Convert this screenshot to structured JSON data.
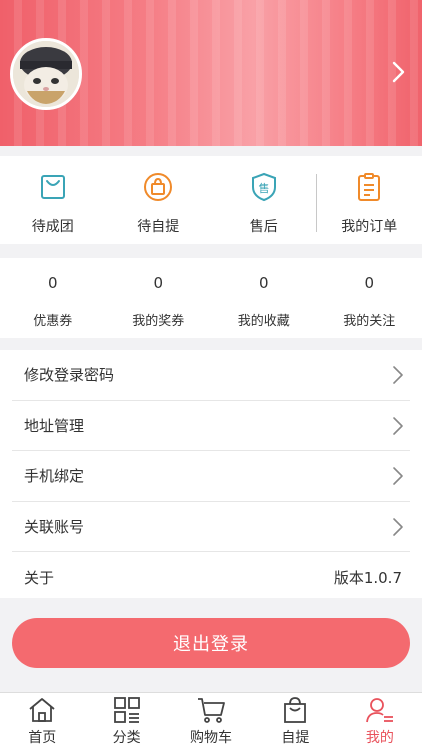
{
  "colors": {
    "accent": "#f46a6f",
    "active_tab": "#e9525c",
    "icon_teal": "#3aa4b6",
    "icon_orange": "#f08a2a"
  },
  "header": {
    "avatar_icon": "cat-avatar",
    "chevron_icon": "chevron-right-icon"
  },
  "orders": [
    {
      "label": "待成团",
      "icon": "bag-icon"
    },
    {
      "label": "待自提",
      "icon": "pickup-bag-icon"
    },
    {
      "label": "售后",
      "icon": "after-sales-shield-icon"
    },
    {
      "label": "我的订单",
      "icon": "clipboard-icon"
    }
  ],
  "counters": [
    {
      "value": "0",
      "label": "优惠券"
    },
    {
      "value": "0",
      "label": "我的奖券"
    },
    {
      "value": "0",
      "label": "我的收藏"
    },
    {
      "value": "0",
      "label": "我的关注"
    }
  ],
  "settings": [
    {
      "label": "修改登录密码"
    },
    {
      "label": "地址管理"
    },
    {
      "label": "手机绑定"
    },
    {
      "label": "关联账号"
    },
    {
      "label": "关于",
      "value": "版本1.0.7"
    }
  ],
  "logout_label": "退出登录",
  "tabs": [
    {
      "label": "首页",
      "icon": "home-icon"
    },
    {
      "label": "分类",
      "icon": "grid-icon"
    },
    {
      "label": "购物车",
      "icon": "cart-icon"
    },
    {
      "label": "自提",
      "icon": "shopping-bag-icon"
    },
    {
      "label": "我的",
      "icon": "user-icon",
      "active": true
    }
  ]
}
